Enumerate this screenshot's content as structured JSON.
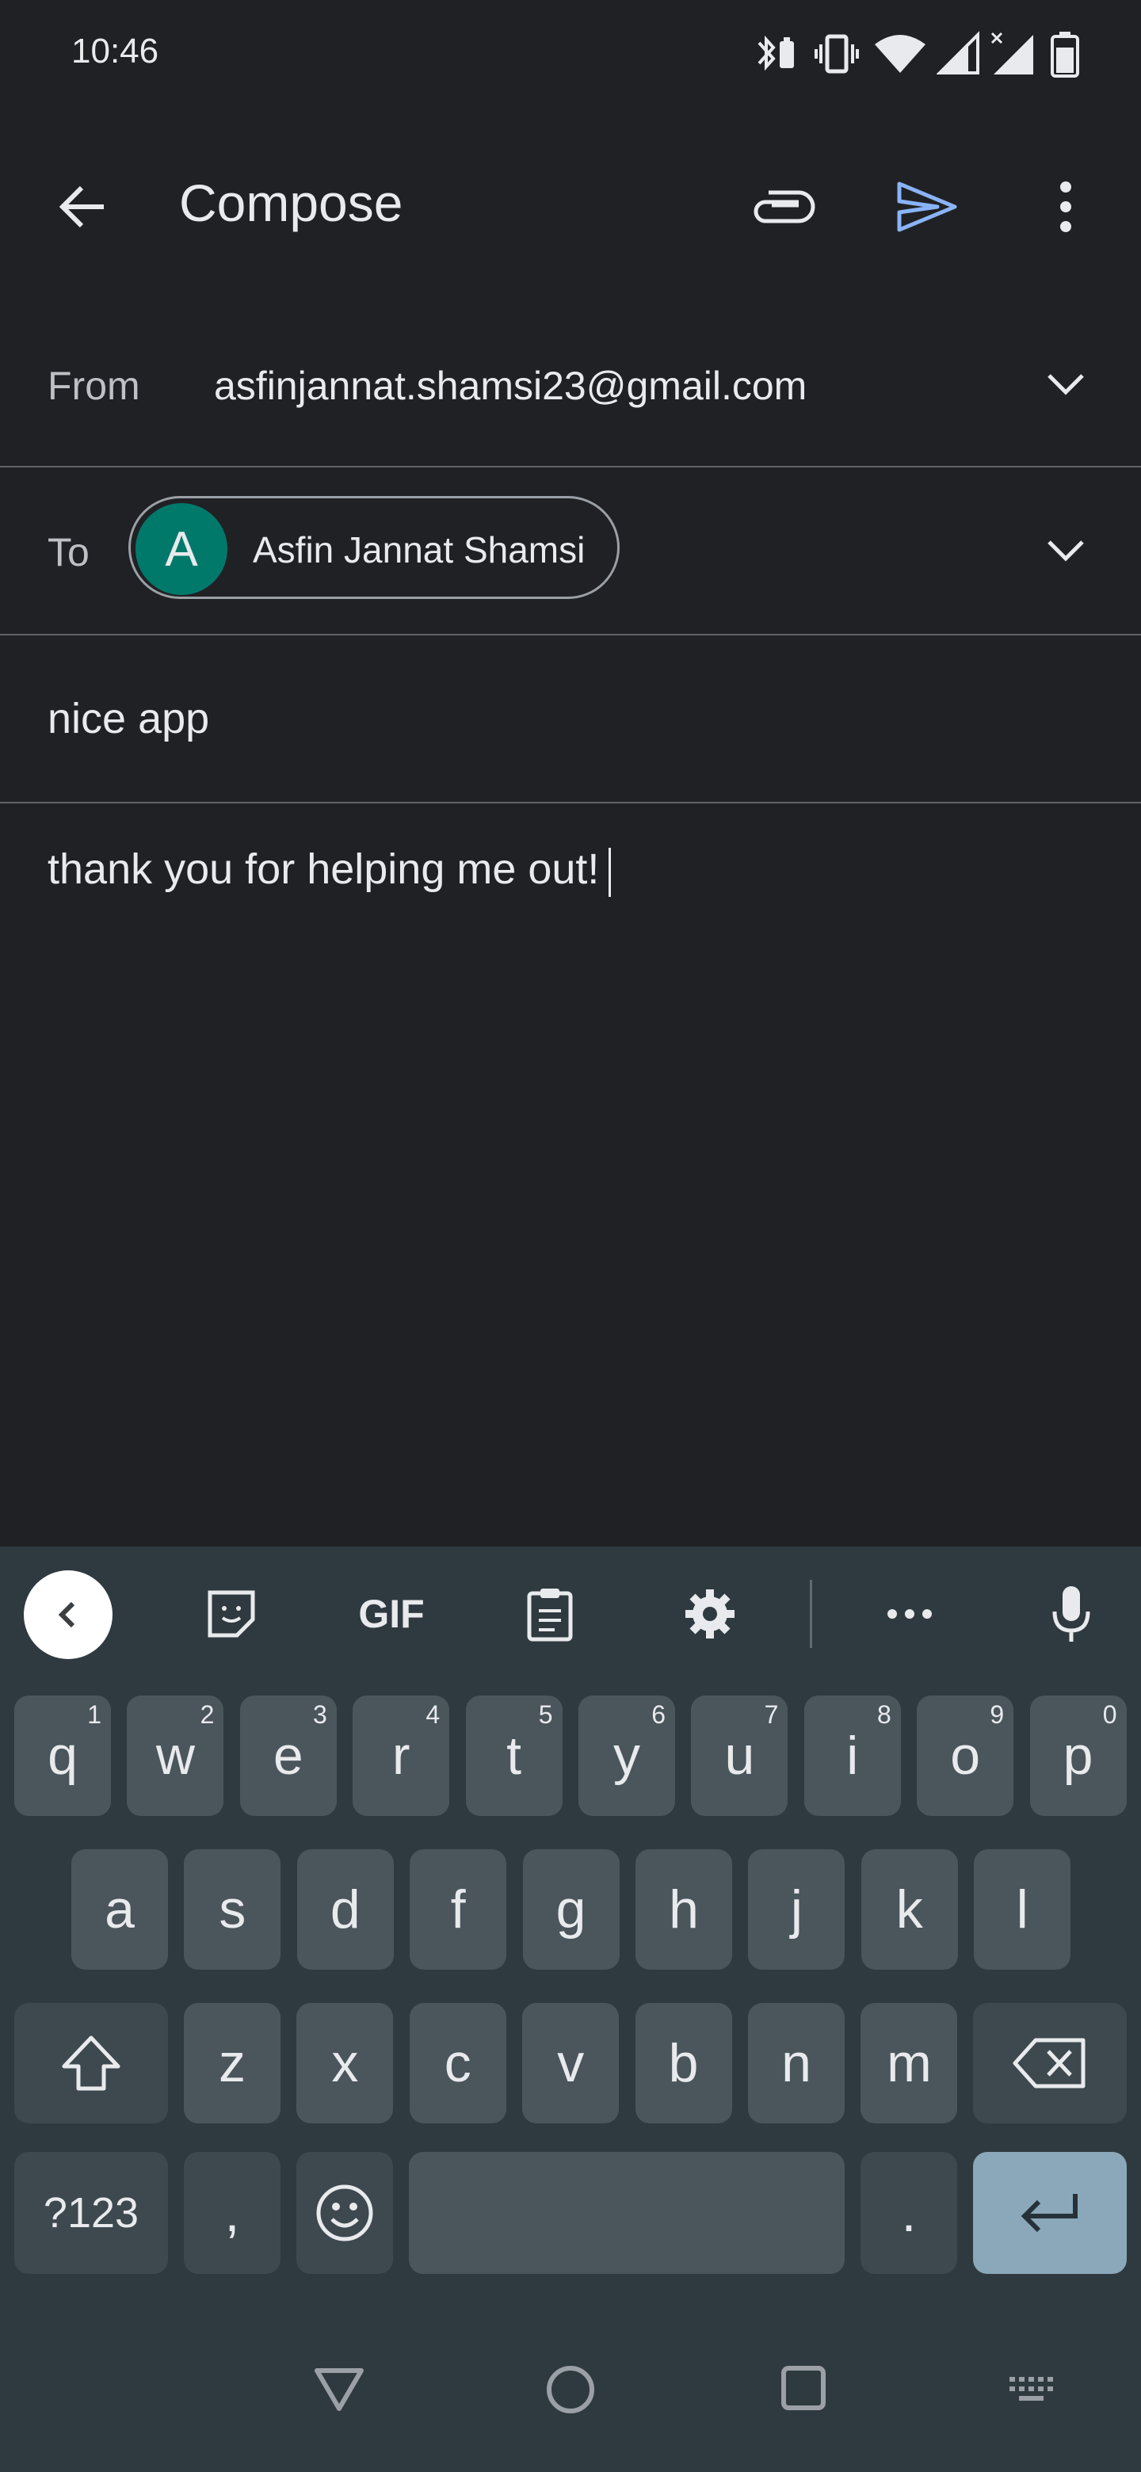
{
  "status_bar": {
    "time": "10:46",
    "icons": [
      "bluetooth-battery-icon",
      "vibrate-icon",
      "wifi-icon",
      "signal-icon",
      "signal-no-data-icon",
      "battery-icon"
    ]
  },
  "app_bar": {
    "title": "Compose",
    "icons": [
      "back-arrow-icon",
      "attachment-icon",
      "send-icon",
      "more-vert-icon"
    ],
    "send_color": "#8ab4f8"
  },
  "compose": {
    "from_label": "From",
    "from_value": "asfinjannat.shamsi23@gmail.com",
    "to_label": "To",
    "recipient": {
      "initial": "A",
      "name": "Asfin Jannat Shamsi",
      "avatar_color": "#00796b"
    },
    "subject": "nice app",
    "body": "thank you for helping me out!"
  },
  "keyboard": {
    "toolbar": [
      "collapse-icon",
      "sticker-icon",
      "gif-icon",
      "clipboard-icon",
      "settings-icon",
      "more-horiz-icon",
      "microphone-icon"
    ],
    "gif_label": "GIF",
    "row1": [
      {
        "k": "q",
        "h": "1"
      },
      {
        "k": "w",
        "h": "2"
      },
      {
        "k": "e",
        "h": "3"
      },
      {
        "k": "r",
        "h": "4"
      },
      {
        "k": "t",
        "h": "5"
      },
      {
        "k": "y",
        "h": "6"
      },
      {
        "k": "u",
        "h": "7"
      },
      {
        "k": "i",
        "h": "8"
      },
      {
        "k": "o",
        "h": "9"
      },
      {
        "k": "p",
        "h": "0"
      }
    ],
    "row2": [
      "a",
      "s",
      "d",
      "f",
      "g",
      "h",
      "j",
      "k",
      "l"
    ],
    "row3": [
      "z",
      "x",
      "c",
      "v",
      "b",
      "n",
      "m"
    ],
    "symbols_label": "?123",
    "comma": ",",
    "period": ".",
    "enter_color": "#8aa8b9"
  },
  "nav_bar": {
    "icons": [
      "back-triangle-icon",
      "home-circle-icon",
      "recents-square-icon",
      "keyboard-switch-icon"
    ]
  }
}
